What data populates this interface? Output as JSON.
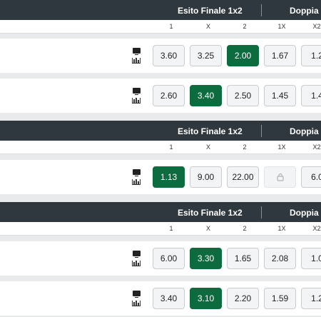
{
  "blocks": [
    {
      "header": {
        "market1": "Esito Finale 1x2",
        "market2": "Doppia C"
      },
      "cols": [
        "1",
        "X",
        "2",
        "1X",
        "X2"
      ],
      "rows": [
        {
          "odds": [
            "3.60",
            "3.25",
            "2.00",
            "1.67",
            "1.2"
          ],
          "selected": 2
        },
        {
          "odds": [
            "2.60",
            "3.40",
            "2.50",
            "1.45",
            "1.4"
          ],
          "selected": 1
        }
      ]
    },
    {
      "header": {
        "market1": "Esito Finale 1x2",
        "market2": "Doppia C"
      },
      "cols": [
        "1",
        "X",
        "2",
        "1X",
        "X2"
      ],
      "rows": [
        {
          "odds": [
            "1.13",
            "9.00",
            "22.00",
            "",
            "6.0"
          ],
          "selected": 0,
          "locked": 3
        }
      ]
    },
    {
      "header": {
        "market1": "Esito Finale 1x2",
        "market2": "Doppia C"
      },
      "cols": [
        "1",
        "X",
        "2",
        "1X",
        "X2"
      ],
      "rows": [
        {
          "odds": [
            "6.00",
            "3.30",
            "1.65",
            "2.08",
            "1.0"
          ],
          "selected": 1
        },
        {
          "odds": [
            "3.40",
            "3.10",
            "2.20",
            "1.59",
            "1.2"
          ],
          "selected": 1
        }
      ]
    }
  ],
  "icons": {
    "tv": "tv-icon",
    "stats": "stats-icon",
    "lock": "lock-icon"
  },
  "colors": {
    "header_bg": "#2f383e",
    "selected_bg": "#0c6b3f"
  }
}
